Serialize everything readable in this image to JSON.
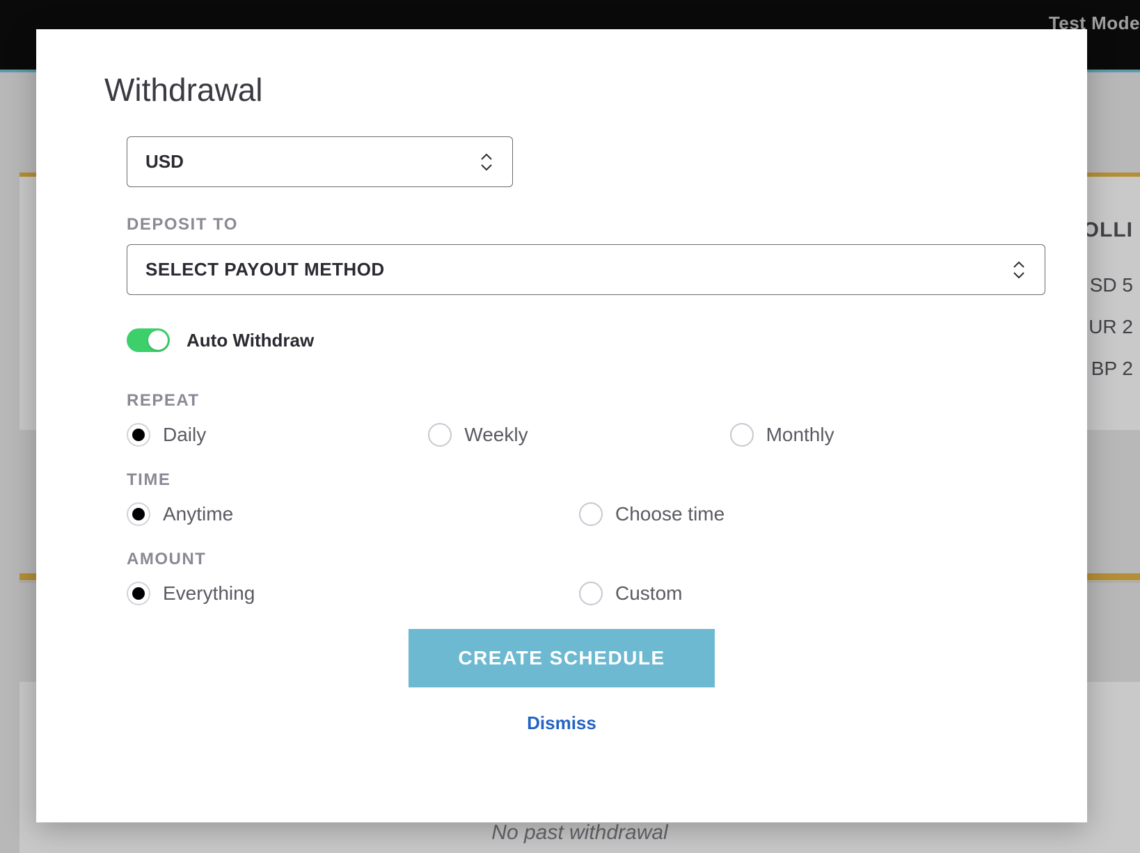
{
  "header": {
    "mode_badge": "Test Mode"
  },
  "background": {
    "rollup_heading_fragment": "OLLI",
    "line1_fragment": "SD 5",
    "line2_fragment": "UR 2",
    "line3_fragment": "BP 2",
    "empty_history": "No past withdrawal"
  },
  "modal": {
    "title": "Withdrawal",
    "currency_selected": "USD",
    "deposit_to_label": "DEPOSIT TO",
    "payout_placeholder": "SELECT PAYOUT METHOD",
    "auto_withdraw_label": "Auto Withdraw",
    "auto_withdraw_on": true,
    "repeat": {
      "label": "REPEAT",
      "options": [
        "Daily",
        "Weekly",
        "Monthly"
      ],
      "selected": "Daily"
    },
    "time": {
      "label": "TIME",
      "options": [
        "Anytime",
        "Choose time"
      ],
      "selected": "Anytime"
    },
    "amount": {
      "label": "AMOUNT",
      "options": [
        "Everything",
        "Custom"
      ],
      "selected": "Everything"
    },
    "primary_button": "CREATE SCHEDULE",
    "dismiss": "Dismiss"
  },
  "colors": {
    "accent_yellow": "#e3b23c",
    "accent_teal": "#6cb9d1",
    "toggle_green": "#3ccf6a",
    "link_blue": "#2463c4"
  }
}
